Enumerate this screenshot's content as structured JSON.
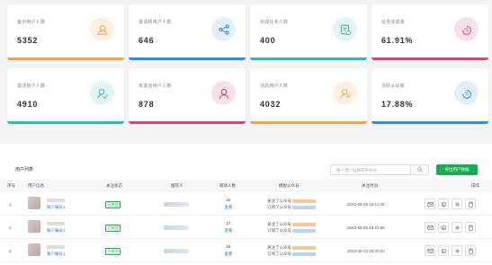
{
  "stats": [
    {
      "label": "备份用户人数",
      "value": "5352",
      "icon": "user-icon",
      "color": "#f0a64a",
      "bg": "#fdf0e2"
    },
    {
      "label": "邀请新用户人数",
      "value": "646",
      "icon": "share-icon",
      "color": "#2f8ee0",
      "bg": "#e3f0fb"
    },
    {
      "label": "完成任务人数",
      "value": "400",
      "icon": "task-icon",
      "color": "#35b9b0",
      "bg": "#e2f5f3"
    },
    {
      "label": "任务完成率",
      "value": "61.91%",
      "icon": "percent-icon",
      "color": "#d84874",
      "bg": "#f9e1e9"
    },
    {
      "label": "激活用户人数",
      "value": "4910",
      "icon": "user-check-icon",
      "color": "#35b9b0",
      "bg": "#e2f5f3"
    },
    {
      "label": "未激活用户人数",
      "value": "878",
      "icon": "user-x-icon",
      "color": "#d84874",
      "bg": "#f9e1e9"
    },
    {
      "label": "活跃用户人数",
      "value": "4032",
      "icon": "user-active-icon",
      "color": "#f0a64a",
      "bg": "#fdf0e2"
    },
    {
      "label": "活跃占比率",
      "value": "17.88%",
      "icon": "percent-icon",
      "color": "#2f8ee0",
      "bg": "#e3f0fb"
    }
  ],
  "table": {
    "title": "用户列表",
    "search_placeholder": "输入用户名称或手机号",
    "export_label": "导出用户数据",
    "headers": [
      "序号",
      "用户信息",
      "关注状态",
      "推荐人",
      "邀请人数",
      "模板公众号",
      "关注时间",
      "操作"
    ],
    "rows": [
      {
        "idx": "1",
        "account": "账户编号1",
        "status": "已关注",
        "count": "24",
        "count_link": "查看",
        "tmp1": "关注了公众号",
        "tmp2": "订阅了公众号",
        "time": "2023-05-25 15:11:09"
      },
      {
        "idx": "2",
        "account": "账户编号1",
        "status": "已关注",
        "count": "17",
        "count_link": "查看",
        "tmp1": "关注了公众号",
        "tmp2": "订阅了公众号",
        "time": "2023-05-25 15:01:58"
      },
      {
        "idx": "3",
        "account": "账户编号1",
        "status": "已关注",
        "count": "16",
        "count_link": "查看",
        "tmp1": "关注了公众号",
        "tmp2": "订阅了公众号",
        "time": "2023-05-23 20:20:42"
      }
    ]
  }
}
